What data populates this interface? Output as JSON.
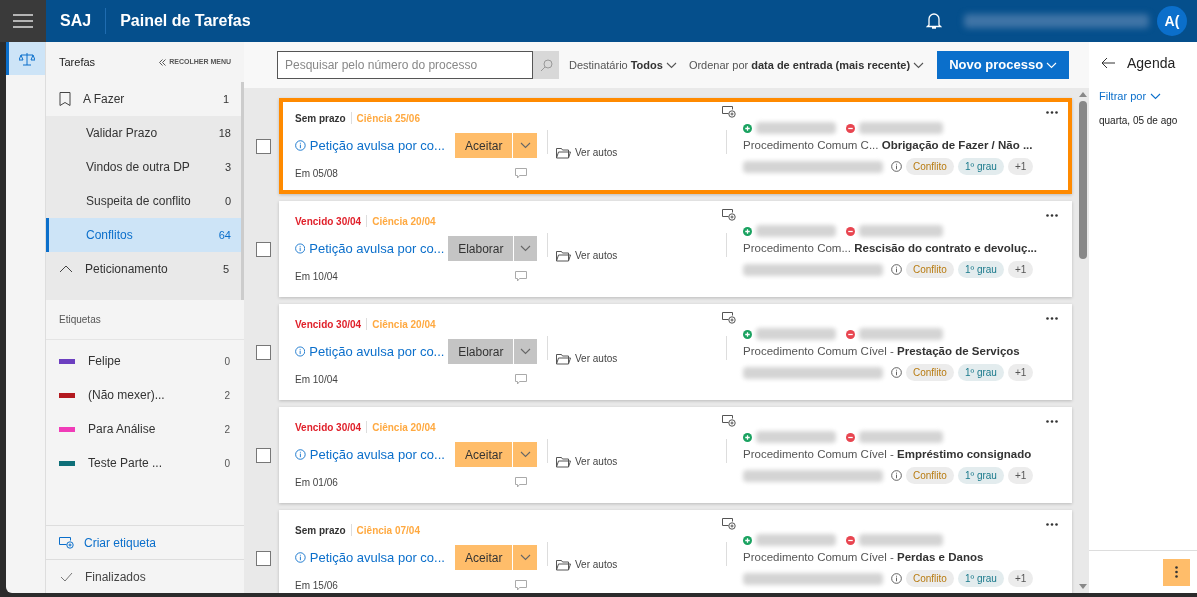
{
  "header": {
    "app": "SAJ",
    "title": "Painel de Tarefas",
    "avatar": "A("
  },
  "sidebar": {
    "title": "Tarefas",
    "collapse": "RECOLHER MENU",
    "groups": [
      {
        "label": "A Fazer",
        "count": "1",
        "kind": "book",
        "expanded": true,
        "children": [
          {
            "label": "Validar Prazo",
            "count": "18",
            "selected": false
          },
          {
            "label": "Vindos de outra DP",
            "count": "3",
            "selected": false
          },
          {
            "label": "Suspeita de conflito",
            "count": "0",
            "selected": false
          },
          {
            "label": "Conflitos",
            "count": "64",
            "selected": true
          }
        ]
      },
      {
        "label": "Peticionamento",
        "count": "5",
        "kind": "chevron",
        "expanded": true
      }
    ],
    "labels_title": "Etiquetas",
    "labels": [
      {
        "name": "Felipe",
        "count": "0",
        "color": "#6c3fc0"
      },
      {
        "name": "(Não mexer)...",
        "count": "2",
        "color": "#b3191f"
      },
      {
        "name": "Para Análise",
        "count": "2",
        "color": "#f03cb8"
      },
      {
        "name": "Teste Parte ...",
        "count": "0",
        "color": "#0e6f78"
      }
    ],
    "create_label": "Criar etiqueta",
    "finished": "Finalizados"
  },
  "toolbar": {
    "search": {
      "placeholder": "Pesquisar pelo número do processo"
    },
    "recipient_label": "Destinatário",
    "recipient_value": "Todos",
    "sort_label": "Ordenar por",
    "sort_value": "data de entrada (mais recente)",
    "new_button": "Novo processo"
  },
  "tasks": [
    {
      "highlighted": true,
      "checked": false,
      "status": {
        "kind": "no_deadline",
        "text": "Sem prazo"
      },
      "notice": "Ciência 25/06",
      "title": "Petição avulsa por co...",
      "action": {
        "kind": "accept",
        "text": "Aceitar"
      },
      "date": "Em 05/08",
      "files": "Ver autos",
      "procedure": "Procedimento Comum C... **Obrigação de Fazer / Não ...**",
      "tags": [
        "Conflito",
        "1º grau",
        "+1"
      ]
    },
    {
      "highlighted": false,
      "checked": false,
      "status": {
        "kind": "overdue",
        "text": "Vencido 30/04"
      },
      "notice": "Ciência 20/04",
      "title": "Petição avulsa por co...",
      "action": {
        "kind": "elaborate",
        "text": "Elaborar"
      },
      "date": "Em 10/04",
      "files": "Ver autos",
      "procedure": "Procedimento Com... **Rescisão do contrato e devoluç...**",
      "tags": [
        "Conflito",
        "1º grau",
        "+1"
      ]
    },
    {
      "highlighted": false,
      "checked": false,
      "status": {
        "kind": "overdue",
        "text": "Vencido 30/04"
      },
      "notice": "Ciência 20/04",
      "title": "Petição avulsa por co...",
      "action": {
        "kind": "elaborate",
        "text": "Elaborar"
      },
      "date": "Em 10/04",
      "files": "Ver autos",
      "procedure": "Procedimento Comum Cível - **Prestação de Serviços**",
      "tags": [
        "Conflito",
        "1º grau",
        "+1"
      ]
    },
    {
      "highlighted": false,
      "checked": false,
      "status": {
        "kind": "overdue",
        "text": "Vencido 30/04"
      },
      "notice": "Ciência 20/04",
      "title": "Petição avulsa por co...",
      "action": {
        "kind": "accept",
        "text": "Aceitar"
      },
      "date": "Em 01/06",
      "files": "Ver autos",
      "procedure": "Procedimento Comum Cível - **Empréstimo consignado**",
      "tags": [
        "Conflito",
        "1º grau",
        "+1"
      ]
    },
    {
      "highlighted": false,
      "checked": false,
      "status": {
        "kind": "no_deadline",
        "text": "Sem prazo"
      },
      "notice": "Ciência 07/04",
      "title": "Petição avulsa por co...",
      "action": {
        "kind": "accept",
        "text": "Aceitar"
      },
      "date": "Em 15/06",
      "files": "Ver autos",
      "procedure": "Procedimento Comum Cível - **Perdas e Danos**",
      "tags": [
        "Conflito",
        "1º grau",
        "+1"
      ]
    }
  ],
  "agenda": {
    "title": "Agenda",
    "filter": "Filtrar por",
    "date": "quarta, 05 de ago"
  }
}
